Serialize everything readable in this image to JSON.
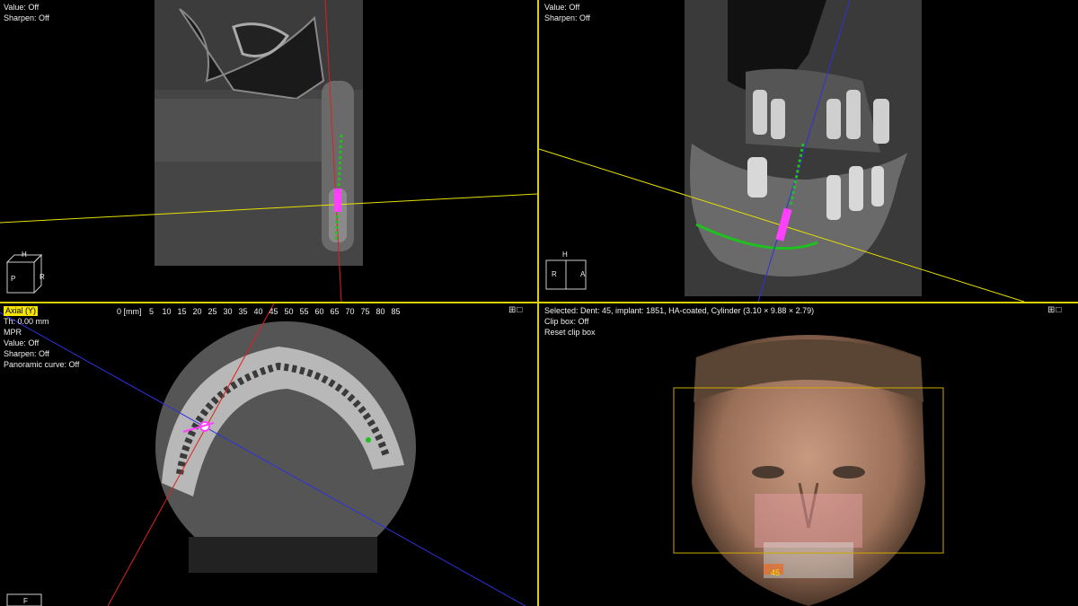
{
  "views": {
    "top_left": {
      "value_line": "Value: Off",
      "sharpen_line": "Sharpen: Off",
      "orientation": {
        "top": "H",
        "left": "P",
        "right": "R"
      }
    },
    "top_right": {
      "value_line": "Value: Off",
      "sharpen_line": "Sharpen: Off",
      "orientation": {
        "top": "H",
        "left": "R",
        "right": "A"
      }
    },
    "bottom_left": {
      "view_name": "Axial (Y)",
      "thickness": "Th: 0.00 mm",
      "mode": "MPR",
      "value_line": "Value: Off",
      "sharpen_line": "Sharpen: Off",
      "panoramic_line": "Panoramic curve: Off",
      "ruler_unit": "0 [mm]",
      "ruler_ticks": [
        "5",
        "10",
        "15",
        "20",
        "25",
        "30",
        "35",
        "40",
        "45",
        "50",
        "55",
        "60",
        "65",
        "70",
        "75",
        "80",
        "85"
      ],
      "orientation": {
        "bottom": "F"
      }
    },
    "bottom_right": {
      "selected_line": "Selected: Dent: 45, implant: 1851, HA-coated, Cylinder (3.10 × 9.88 × 2.79)",
      "clip_box_line": "Clip box: Off",
      "reset_clip_line": "Reset clip box",
      "tooth_label": "45"
    }
  },
  "window_buttons": "⊞□",
  "colors": {
    "divider": "#d8d000",
    "yellow_axis": "#e8e000",
    "red_axis": "#e02020",
    "blue_axis": "#3030e0",
    "implant": "#ff40ff",
    "nerve": "#20c020"
  }
}
